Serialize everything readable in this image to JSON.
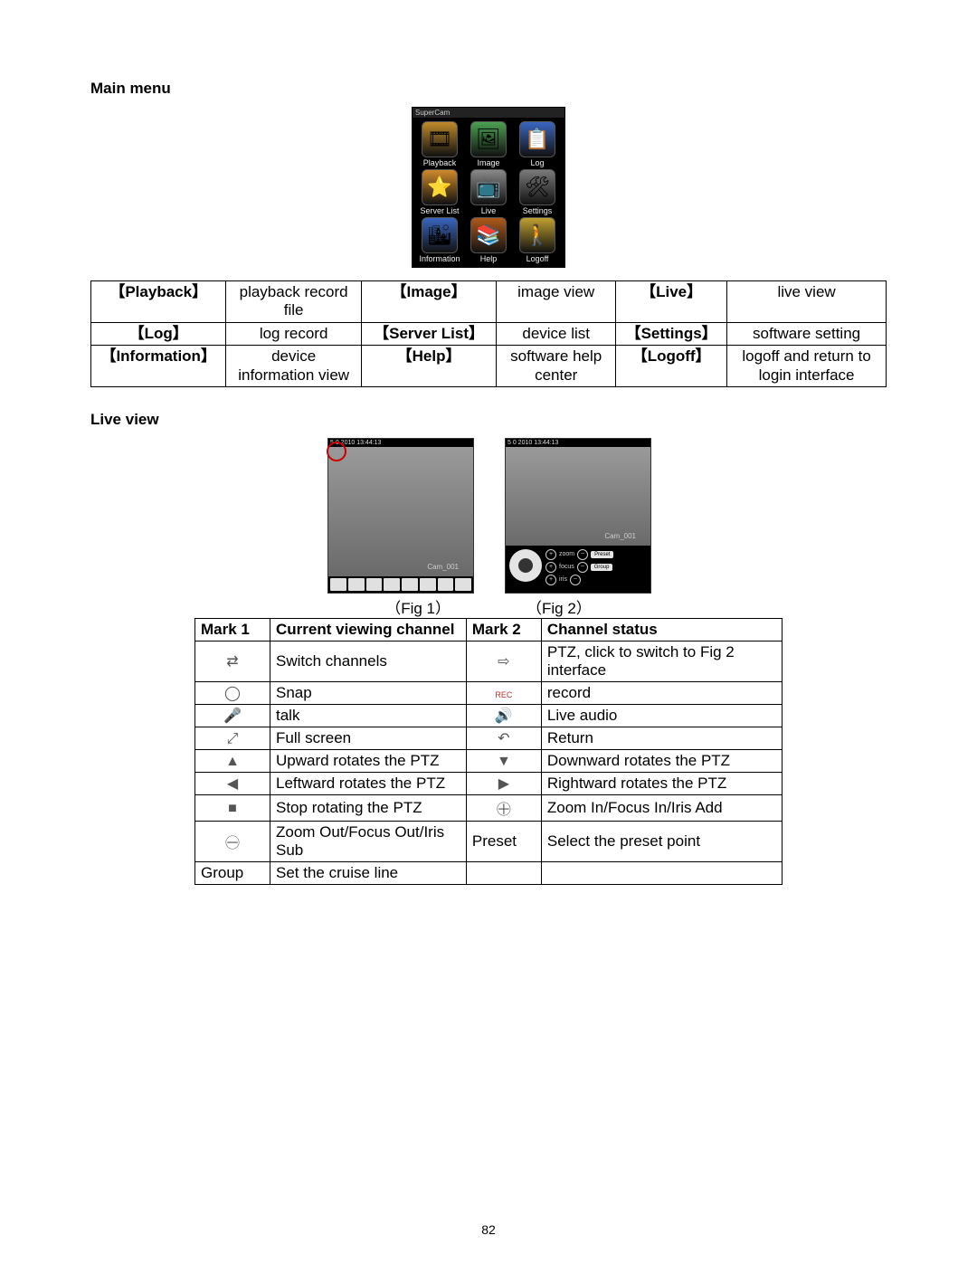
{
  "sections": {
    "main_menu_title": "Main menu",
    "live_view_title": "Live view"
  },
  "phone": {
    "title": "SuperCam",
    "icons": [
      {
        "label": "Playback",
        "color": "#c08a2a",
        "glyph": "🎞"
      },
      {
        "label": "Image",
        "color": "#4aa050",
        "glyph": "🖼"
      },
      {
        "label": "Log",
        "color": "#3a66c0",
        "glyph": "📋"
      },
      {
        "label": "Server List",
        "color": "#d08a2a",
        "glyph": "⭐"
      },
      {
        "label": "Live",
        "color": "#8a8a8a",
        "glyph": "📺"
      },
      {
        "label": "Settings",
        "color": "#7a7a7a",
        "glyph": "🛠"
      },
      {
        "label": "Information",
        "color": "#3a66c0",
        "glyph": "🏙"
      },
      {
        "label": "Help",
        "color": "#b05a1a",
        "glyph": "📚"
      },
      {
        "label": "Logoff",
        "color": "#c0a030",
        "glyph": "🚶"
      }
    ]
  },
  "menu_table": [
    {
      "k1": "【Playback】",
      "v1": "playback record file",
      "k2": "【Image】",
      "v2": "image view",
      "k3": "【Live】",
      "v3": "live view"
    },
    {
      "k1": "【Log】",
      "v1": "log record",
      "k2": "【Server List】",
      "v2": "device list",
      "k3": "【Settings】",
      "v3": "software setting"
    },
    {
      "k1": "【Information】",
      "v1": "device information view",
      "k2": "【Help】",
      "v2": "software help center",
      "k3": "【Logoff】",
      "v3": "logoff and return to login interface"
    }
  ],
  "live_view": {
    "timestamp1": "5  0 2010 13:44:13",
    "timestamp2": "5  0 2010 13:44:13",
    "camname": "Cam_001",
    "ptz_rows": [
      {
        "sym": "+",
        "label": "zoom",
        "btn": "Preset"
      },
      {
        "sym": "+",
        "label": "focus",
        "btn": "Group"
      },
      {
        "sym": "+",
        "label": "iris",
        "btn": ""
      }
    ],
    "fig1_caption": "（Fig 1）",
    "fig2_caption": "（Fig 2）"
  },
  "lv_table": {
    "headers": {
      "h1": "Mark 1",
      "h2": "Current viewing channel",
      "h3": "Mark 2",
      "h4": "Channel status"
    },
    "rows": [
      {
        "i1": "⇄",
        "t1": "Switch channels",
        "i2": "⇨",
        "t2": "PTZ, click to switch to Fig 2 interface",
        "ptz_justify": true
      },
      {
        "i1": "◯",
        "t1": "Snap",
        "i2": "REC",
        "t2": "record"
      },
      {
        "i1": "🎤",
        "t1": "talk",
        "i2": "🔊",
        "t2": "Live audio"
      },
      {
        "i1": "⤢",
        "t1": "Full screen",
        "i2": "↶",
        "t2": "Return"
      },
      {
        "i1": "▲",
        "t1": "Upward rotates the PTZ",
        "i2": "▼",
        "t2": "Downward rotates the PTZ"
      },
      {
        "i1": "◀",
        "t1": "Leftward rotates the PTZ",
        "i2": "▶",
        "t2": "Rightward rotates the PTZ"
      },
      {
        "i1": "■",
        "t1": "Stop rotating the PTZ",
        "i2": "＋⃝",
        "t2": "Zoom In/Focus In/Iris Add"
      },
      {
        "i1": "－⃝",
        "t1": "Zoom Out/Focus Out/Iris Sub",
        "i2": "Preset",
        "t2": "Select the preset point",
        "preset_text": true
      },
      {
        "i1": "Group",
        "t1": "Set the cruise line",
        "i2": "",
        "t2": "",
        "group_text": true
      }
    ]
  },
  "page_number": "82"
}
